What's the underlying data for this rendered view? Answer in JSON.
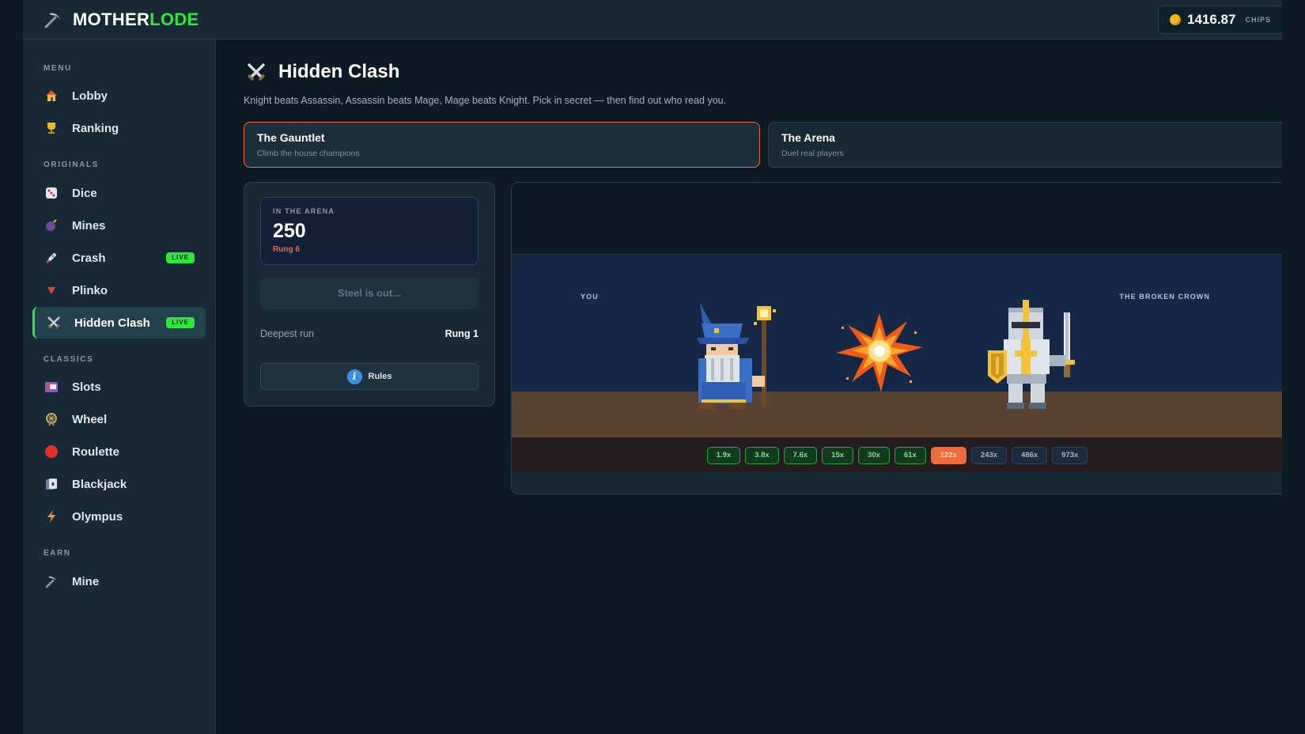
{
  "brand": {
    "name_white": "MOTHER",
    "name_green": "LODE",
    "icon": "pickaxe-icon"
  },
  "balance": {
    "value": "1416.87",
    "unit": "CHIPS"
  },
  "sidebar": {
    "sections": [
      {
        "label": "MENU",
        "items": [
          {
            "label": "Lobby",
            "icon": "house-icon"
          },
          {
            "label": "Ranking",
            "icon": "trophy-icon"
          }
        ]
      },
      {
        "label": "ORIGINALS",
        "items": [
          {
            "label": "Dice",
            "icon": "dice-icon"
          },
          {
            "label": "Mines",
            "icon": "bomb-icon"
          },
          {
            "label": "Crash",
            "icon": "rocket-icon",
            "badge": "LIVE"
          },
          {
            "label": "Plinko",
            "icon": "triangle-down-icon"
          },
          {
            "label": "Hidden Clash",
            "icon": "crossed-swords-icon",
            "badge": "LIVE",
            "active": true
          }
        ]
      },
      {
        "label": "CLASSICS",
        "items": [
          {
            "label": "Slots",
            "icon": "slot-machine-icon"
          },
          {
            "label": "Wheel",
            "icon": "ferris-wheel-icon"
          },
          {
            "label": "Roulette",
            "icon": "red-circle-icon"
          },
          {
            "label": "Blackjack",
            "icon": "cards-icon"
          },
          {
            "label": "Olympus",
            "icon": "lightning-icon"
          }
        ]
      },
      {
        "label": "EARN",
        "items": [
          {
            "label": "Mine",
            "icon": "pickaxe-icon"
          }
        ]
      }
    ]
  },
  "page": {
    "title": "Hidden Clash",
    "subtitle": "Knight beats Assassin, Assassin beats Mage, Mage beats Knight. Pick in secret — then find out who read you."
  },
  "modes": [
    {
      "title": "The Gauntlet",
      "sub": "Climb the house champions",
      "selected": true
    },
    {
      "title": "The Arena",
      "sub": "Duel real players",
      "selected": false
    }
  ],
  "panel": {
    "stake_label": "IN THE ARENA",
    "stake_value": "250",
    "rung": "Rung 6",
    "status": "Steel is out...",
    "deepest_label": "Deepest run",
    "deepest_value": "Rung 1",
    "rules_label": "Rules"
  },
  "arena": {
    "left_label": "YOU",
    "right_label": "THE BROKEN CROWN",
    "multipliers": [
      "1.9x",
      "3.8x",
      "7.6x",
      "15x",
      "30x",
      "61x",
      "122x",
      "243x",
      "486x",
      "973x"
    ],
    "current_index": 6
  },
  "colors": {
    "accent_green": "#2ee83d",
    "accent_orange": "#f06a3a",
    "bg": "#0b1a23",
    "panel": "#172a36"
  }
}
